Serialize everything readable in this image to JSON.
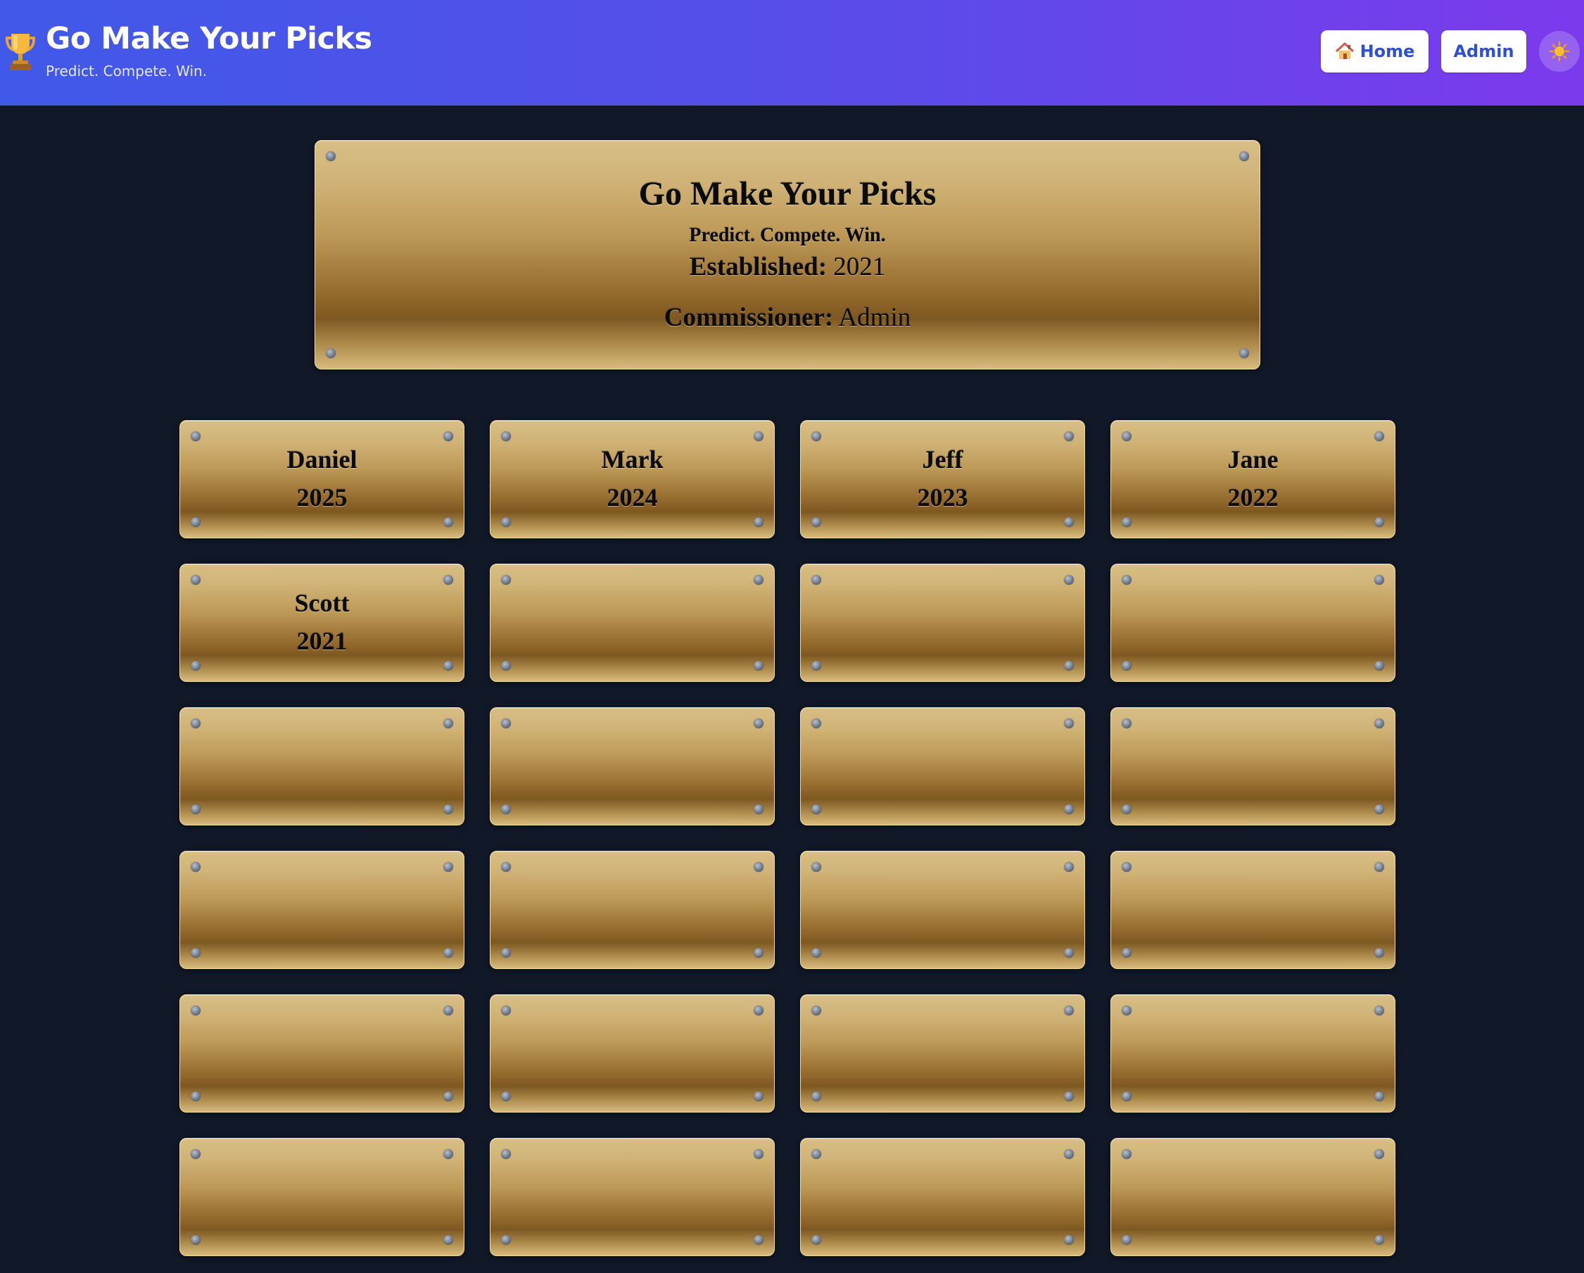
{
  "header": {
    "title": "Go Make Your Picks",
    "tagline": "Predict. Compete. Win.",
    "brand_icon": "trophy-icon",
    "nav": {
      "home_label": "Home",
      "home_icon": "house-icon",
      "admin_label": "Admin"
    },
    "theme_toggle_icon": "sun-icon"
  },
  "main_plaque": {
    "title": "Go Make Your Picks",
    "tagline": "Predict. Compete. Win.",
    "established_label": "Established:",
    "established_value": "2021",
    "commissioner_label": "Commissioner:",
    "commissioner_value": "Admin"
  },
  "champions": [
    {
      "name": "Daniel",
      "year": "2025"
    },
    {
      "name": "Mark",
      "year": "2024"
    },
    {
      "name": "Jeff",
      "year": "2023"
    },
    {
      "name": "Jane",
      "year": "2022"
    },
    {
      "name": "Scott",
      "year": "2021"
    },
    {
      "name": "",
      "year": ""
    },
    {
      "name": "",
      "year": ""
    },
    {
      "name": "",
      "year": ""
    },
    {
      "name": "",
      "year": ""
    },
    {
      "name": "",
      "year": ""
    },
    {
      "name": "",
      "year": ""
    },
    {
      "name": "",
      "year": ""
    },
    {
      "name": "",
      "year": ""
    },
    {
      "name": "",
      "year": ""
    },
    {
      "name": "",
      "year": ""
    },
    {
      "name": "",
      "year": ""
    },
    {
      "name": "",
      "year": ""
    },
    {
      "name": "",
      "year": ""
    },
    {
      "name": "",
      "year": ""
    },
    {
      "name": "",
      "year": ""
    },
    {
      "name": "",
      "year": ""
    },
    {
      "name": "",
      "year": ""
    },
    {
      "name": "",
      "year": ""
    },
    {
      "name": "",
      "year": ""
    }
  ],
  "colors": {
    "header_gradient_start": "#4059e9",
    "header_gradient_end": "#7c3aed",
    "page_background": "#111827",
    "brass": "#bc9856",
    "button_text": "#2e4fd4"
  }
}
